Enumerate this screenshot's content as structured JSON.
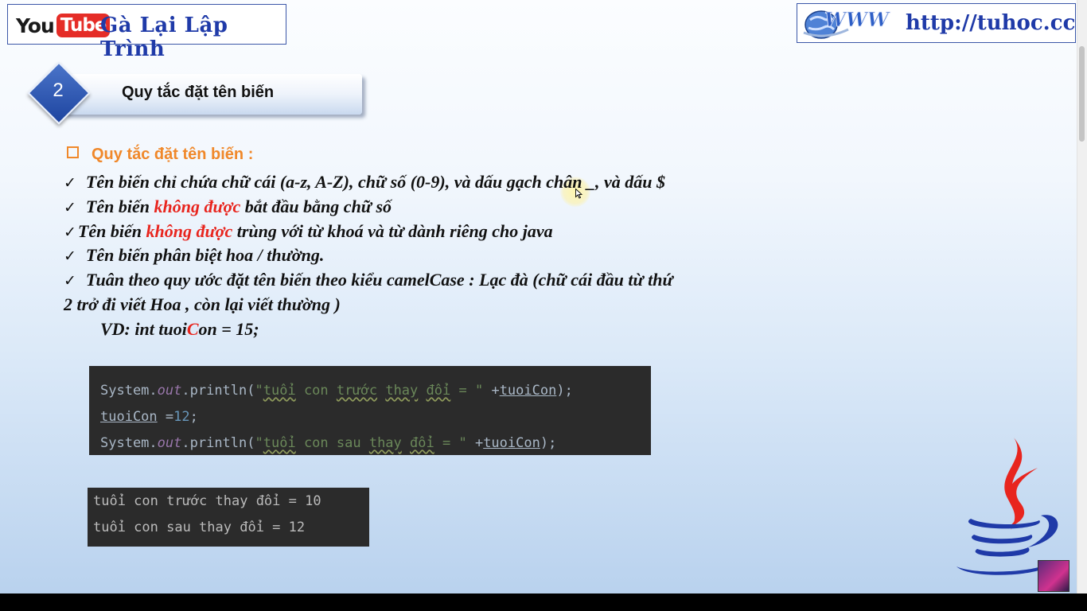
{
  "header": {
    "youtube_logo": {
      "you": "You",
      "tube": "Tube"
    },
    "channel_name": "Gà Lại Lập Trình",
    "www_logo": "WWW",
    "site_url": "http://tuhoc.cc"
  },
  "section": {
    "number": "2",
    "title": "Quy tắc đặt tên biến"
  },
  "rules": {
    "heading": "Quy tắc đặt tên  biến  :",
    "check_glyph": "✓",
    "items": [
      {
        "text": "Tên biến chỉ chứa chữ cái (a-z, A-Z), chữ số (0-9), và dấu gạch chân _, và dấu $"
      },
      {
        "before": "Tên biến ",
        "highlight": "không được",
        "after": " bắt đầu bằng chữ số"
      },
      {
        "before": "Tên biến ",
        "highlight": "không được",
        "after": " trùng với từ khoá và từ dành riêng cho java"
      },
      {
        "text": "Tên biến phân biệt hoa / thường."
      },
      {
        "text": "Tuân theo quy ước đặt tên biến theo kiểu camelCase : Lạc đà (chữ cái đầu từ thứ",
        "continuation": "2 trở đi viết Hoa , còn lại viết thường )"
      }
    ],
    "example": {
      "before": "VD: int tuoi",
      "highlight": "C",
      "after": "on = 15;"
    }
  },
  "code": {
    "line1": {
      "obj": "System.",
      "field": "out",
      "call": ".println(",
      "q1": "\"",
      "s1": "tuổi",
      "sp1": " con ",
      "s2": "trước",
      "sp2": " ",
      "s3": "thay",
      "sp3": " ",
      "s4": "đổi",
      "tail": " = \"",
      "plus": " +",
      "var": "tuoiCon",
      "end": ");"
    },
    "line2": {
      "var": "tuoiCon",
      "op": " =",
      "num": "12",
      "end": ";"
    },
    "line3": {
      "obj": "System.",
      "field": "out",
      "call": ".println(",
      "q1": "\"",
      "s1": "tuổi",
      "sp1": " con sau ",
      "s2": "thay",
      "sp2": " ",
      "s3": "đổi",
      "tail": " = \"",
      "plus": " +",
      "var": "tuoiCon",
      "end": ");"
    }
  },
  "console": {
    "lines": [
      "tuổi con trước thay đổi = 10",
      "tuổi con sau thay đổi = 12"
    ]
  },
  "colors": {
    "accent_blue": "#1f3aa8",
    "highlight_red": "#e8251e",
    "heading_orange": "#f0882a",
    "code_bg": "#2b2b2b"
  }
}
